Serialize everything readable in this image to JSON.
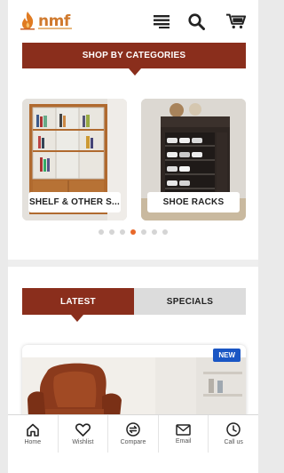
{
  "header": {
    "logo_text": "nmf",
    "icons": [
      "menu-icon",
      "search-icon",
      "cart-icon"
    ]
  },
  "categories": {
    "heading": "SHOP BY CATEGORIES",
    "items": [
      {
        "label": "SHELF & OTHER S..."
      },
      {
        "label": "SHOE RACKS"
      }
    ],
    "dots_count": 7,
    "active_dot": 4
  },
  "tabs": {
    "latest": "LATEST",
    "specials": "SPECIALS"
  },
  "product": {
    "badge": "NEW"
  },
  "bottom_nav": {
    "home": "Home",
    "wishlist": "Wishlist",
    "compare": "Compare",
    "email": "Email",
    "call": "Call us"
  },
  "colors": {
    "brand_maroon": "#8a2e1c",
    "accent_orange": "#e8682a",
    "badge_blue": "#1a56c4"
  }
}
